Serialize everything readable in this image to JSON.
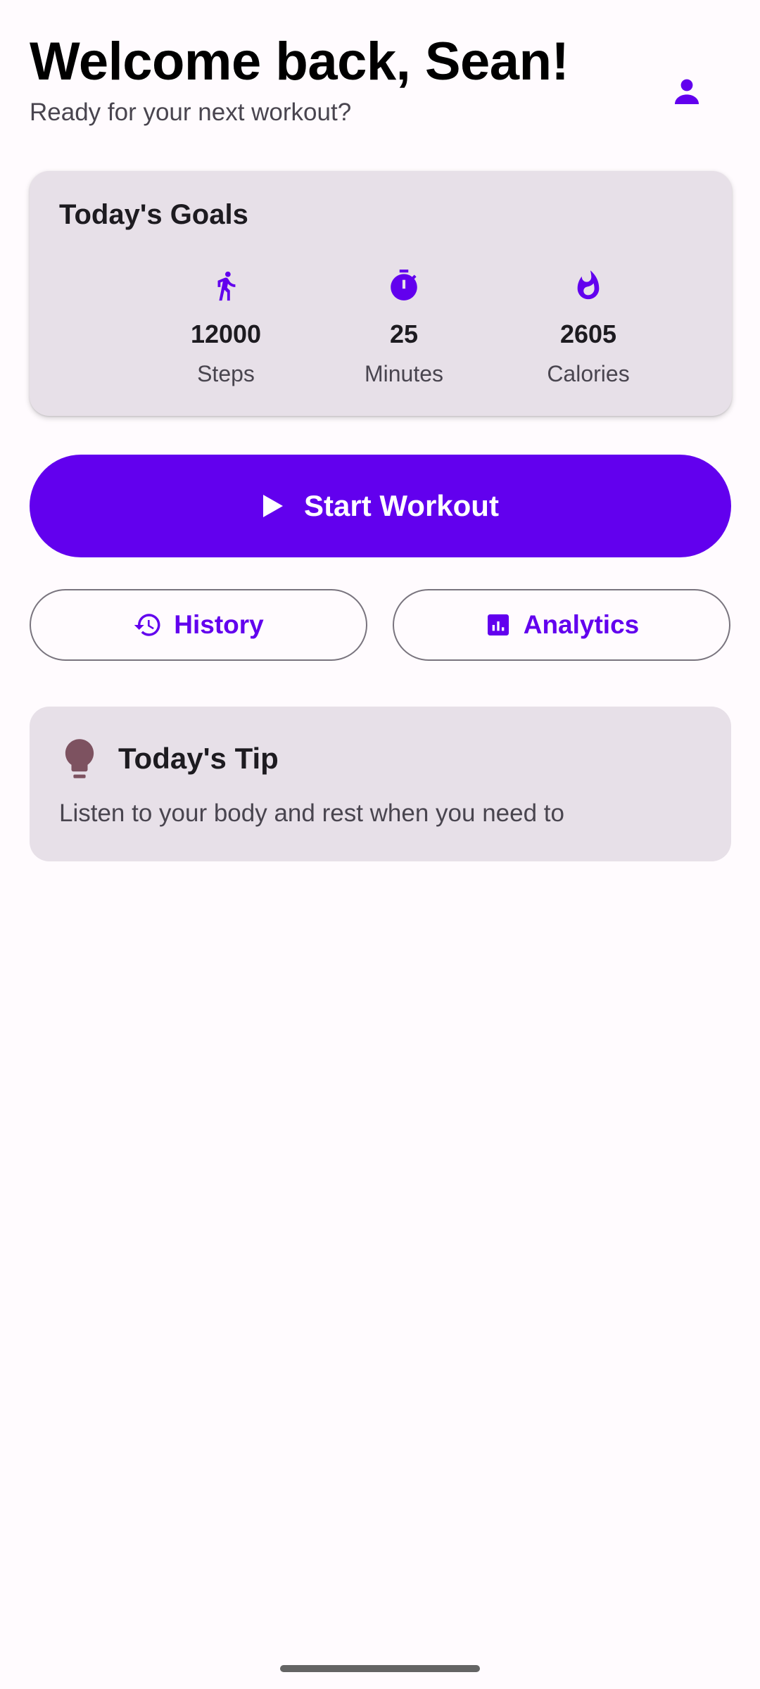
{
  "header": {
    "title": "Welcome back, Sean!",
    "subtitle": "Ready for your next workout?",
    "profile_icon": "person-icon"
  },
  "goals": {
    "title": "Today's Goals",
    "items": [
      {
        "icon": "walk-icon",
        "value": "12000",
        "label": "Steps"
      },
      {
        "icon": "timer-icon",
        "value": "25",
        "label": "Minutes"
      },
      {
        "icon": "fire-icon",
        "value": "2605",
        "label": "Calories"
      }
    ]
  },
  "actions": {
    "start_label": "Start Workout",
    "start_icon": "play-icon",
    "history_label": "History",
    "history_icon": "history-icon",
    "analytics_label": "Analytics",
    "analytics_icon": "analytics-icon"
  },
  "tip": {
    "title": "Today's Tip",
    "text": "Listen to your body and rest when you need to",
    "icon": "lightbulb-icon"
  },
  "colors": {
    "primary": "#6200ee",
    "surface_variant": "#e7e0e8",
    "tip_icon": "#7d5260",
    "background": "#fffbfe"
  }
}
